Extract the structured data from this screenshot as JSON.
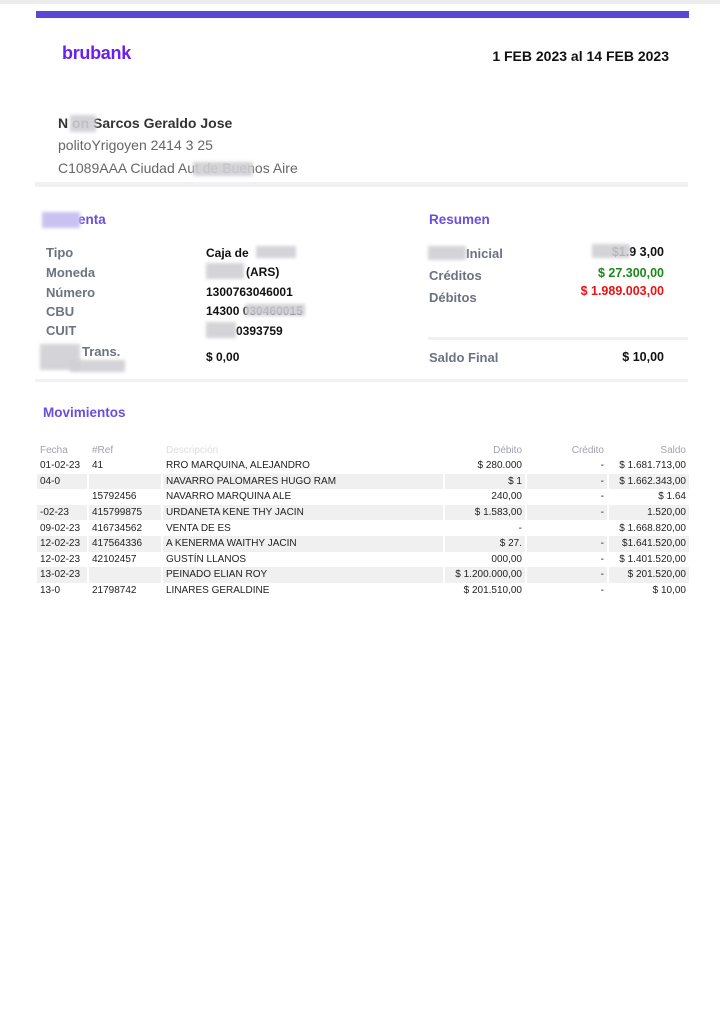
{
  "header": {
    "logo": "brubank",
    "period": "1 FEB 2023 al 14 FEB 2023",
    "brand_color": "#6a1ff0",
    "accent_bar_color": "#5b47d6"
  },
  "client": {
    "name": "N   on Sarcos Geraldo Jose",
    "address1": "politoYrigoyen 2414 3 25",
    "address2": "C1089AAA Ciudad Aut        de Buenos Aire"
  },
  "account": {
    "title": "enta",
    "rows": [
      {
        "label": "Tipo",
        "value": "Caja de"
      },
      {
        "label": "Moneda",
        "value": "(ARS)"
      },
      {
        "label": "Número",
        "value": "1300763046001"
      },
      {
        "label": "CBU",
        "value": "14300         030460015"
      },
      {
        "label": "CUIT",
        "value": "0393759"
      },
      {
        "label": "Trans.",
        "value": "$ 0,00"
      }
    ]
  },
  "summary": {
    "title": "Resumen",
    "initial_label": "Inicial",
    "initial_value": "$1.9       3,00",
    "credits_label": "Créditos",
    "credits_value": "$ 27.300,00",
    "debits_label": "Débitos",
    "debits_value": "$ 1.989.003,00",
    "final_label": "Saldo Final",
    "final_value": "$ 10,00",
    "credit_color": "#1a8a1a",
    "debit_color": "#ee1111"
  },
  "movements": {
    "title": "Movimientos",
    "columns": [
      "Fecha",
      "#Ref",
      "Descripción",
      "Débito",
      "Crédito",
      "Saldo"
    ],
    "rows": [
      [
        "01-02-23",
        "41",
        "RRO MARQUINA, ALEJANDRO",
        "$ 280.000",
        "-",
        "$ 1.681.713,00"
      ],
      [
        "04-0",
        "",
        "NAVARRO PALOMARES HUGO RAM",
        "$ 1",
        "-",
        "$ 1.662.343,00"
      ],
      [
        "",
        "15792456",
        "NAVARRO MARQUINA ALE",
        "240,00",
        "-",
        "$ 1.64"
      ],
      [
        "-02-23",
        "415799875",
        "URDANETA KENE      THY JACIN",
        "$ 1.583,00",
        "-",
        "1.520,00"
      ],
      [
        "09-02-23",
        "416734562",
        "VENTA DE     ES",
        "-",
        "",
        "$ 1.668.820,00"
      ],
      [
        "12-02-23",
        "417564336",
        "A KENERMA WAITHY JACIN",
        "$ 27.",
        "-",
        "$1.641.520,00"
      ],
      [
        "12-02-23",
        "42102457",
        "GUSTÍN LLANOS",
        "000,00",
        "-",
        "$ 1.401.520,00"
      ],
      [
        "13-02-23",
        "",
        "PEINADO ELIAN ROY",
        "$ 1.200.000,00",
        "-",
        "$ 201.520,00"
      ],
      [
        "13-0",
        "21798742",
        "LINARES GERALDINE",
        "$ 201.510,00",
        "-",
        "$ 10,00"
      ]
    ]
  }
}
